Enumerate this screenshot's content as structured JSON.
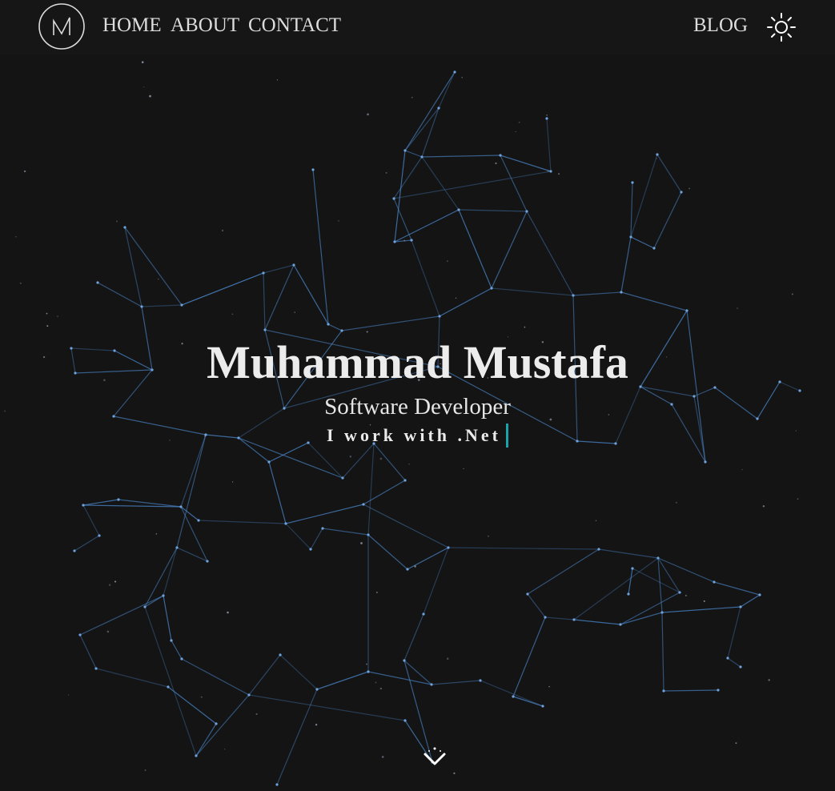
{
  "nav": {
    "logo_icon": "mm-monogram-logo",
    "links": [
      "HOME",
      "ABOUT",
      "CONTACT"
    ],
    "blog_label": "BLOG",
    "theme_icon": "sun-icon"
  },
  "hero": {
    "name": "Muhammad Mustafa",
    "role": "Software Developer",
    "typed_prefix": "I work with",
    "typed_value": ".Net"
  },
  "scroll_icon": "chevron-down-icon",
  "colors": {
    "background": "#141415",
    "network_line": "#4a86c8",
    "cursor": "#19a3ad",
    "text": "#ececec"
  }
}
